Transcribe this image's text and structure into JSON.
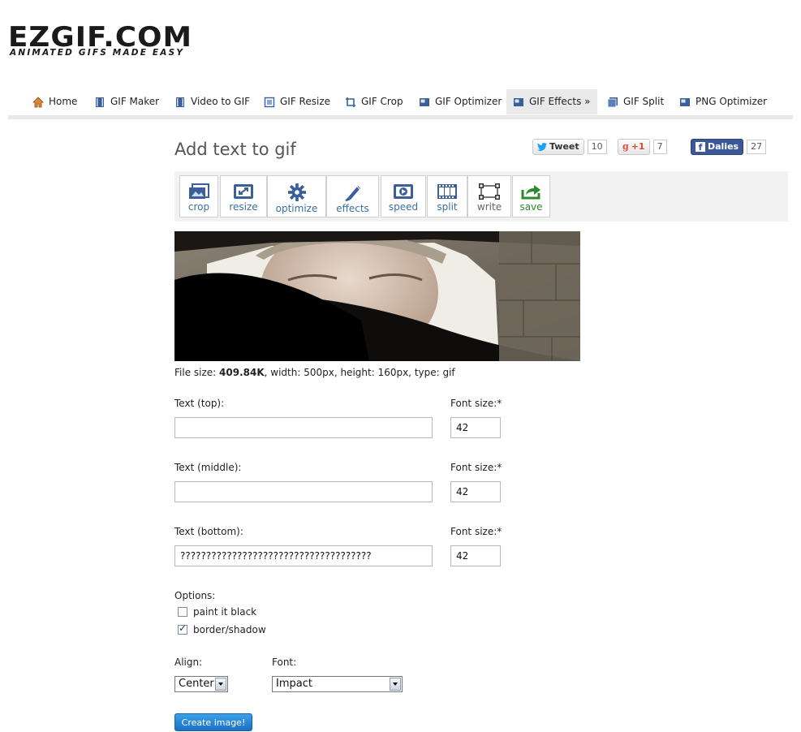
{
  "logo": {
    "main": "EZGIF.COM",
    "tagline": "ANIMATED GIFS MADE EASY"
  },
  "nav": [
    {
      "label": "Home",
      "icon": "home-icon"
    },
    {
      "label": "GIF Maker",
      "icon": "film-icon"
    },
    {
      "label": "Video to GIF",
      "icon": "film-icon"
    },
    {
      "label": "GIF Resize",
      "icon": "resize-icon"
    },
    {
      "label": "GIF Crop",
      "icon": "crop-icon"
    },
    {
      "label": "GIF Optimizer",
      "icon": "image-icon"
    },
    {
      "label": "GIF Effects »",
      "icon": "image-icon",
      "active": true
    },
    {
      "label": "GIF Split",
      "icon": "split-icon"
    },
    {
      "label": "PNG Optimizer",
      "icon": "image-icon"
    }
  ],
  "page": {
    "title": "Add text to gif"
  },
  "social": {
    "tweet": {
      "label": "Tweet",
      "count": "10"
    },
    "gplus": {
      "label": "+1",
      "count": "7"
    },
    "facebook": {
      "label": "Dalies",
      "count": "27"
    }
  },
  "tools": [
    {
      "label": "crop",
      "icon": "crop-icon"
    },
    {
      "label": "resize",
      "icon": "resize-icon"
    },
    {
      "label": "optimize",
      "icon": "gear-icon"
    },
    {
      "label": "effects",
      "icon": "brush-icon"
    },
    {
      "label": "speed",
      "icon": "speed-icon"
    },
    {
      "label": "split",
      "icon": "film-icon"
    },
    {
      "label": "write",
      "icon": "write-icon"
    },
    {
      "label": "save",
      "icon": "save-icon"
    }
  ],
  "fileinfo": {
    "prefix": "File size: ",
    "size": "409.84K",
    "rest": ", width: 500px, height: 160px, type: gif"
  },
  "form": {
    "top_label": "Text (top):",
    "middle_label": "Text (middle):",
    "bottom_label": "Text (bottom):",
    "font_size_label": "Font size:*",
    "top_value": "",
    "middle_value": "",
    "bottom_value": "?????????????????????????????????????",
    "top_size": "42",
    "middle_size": "42",
    "bottom_size": "42",
    "options_label": "Options:",
    "opt_black": "paint it black",
    "opt_border": "border/shadow",
    "align_label": "Align:",
    "align_value": "Center",
    "font_label": "Font:",
    "font_value": "Impact",
    "submit": "Create image!"
  },
  "colors": {
    "accent": "#3a6fa0",
    "save": "#2b8a2b",
    "button": "#1a6fc4",
    "twitter": "#1da1f2",
    "facebook": "#3b5998",
    "gplus": "#dd4b39"
  }
}
